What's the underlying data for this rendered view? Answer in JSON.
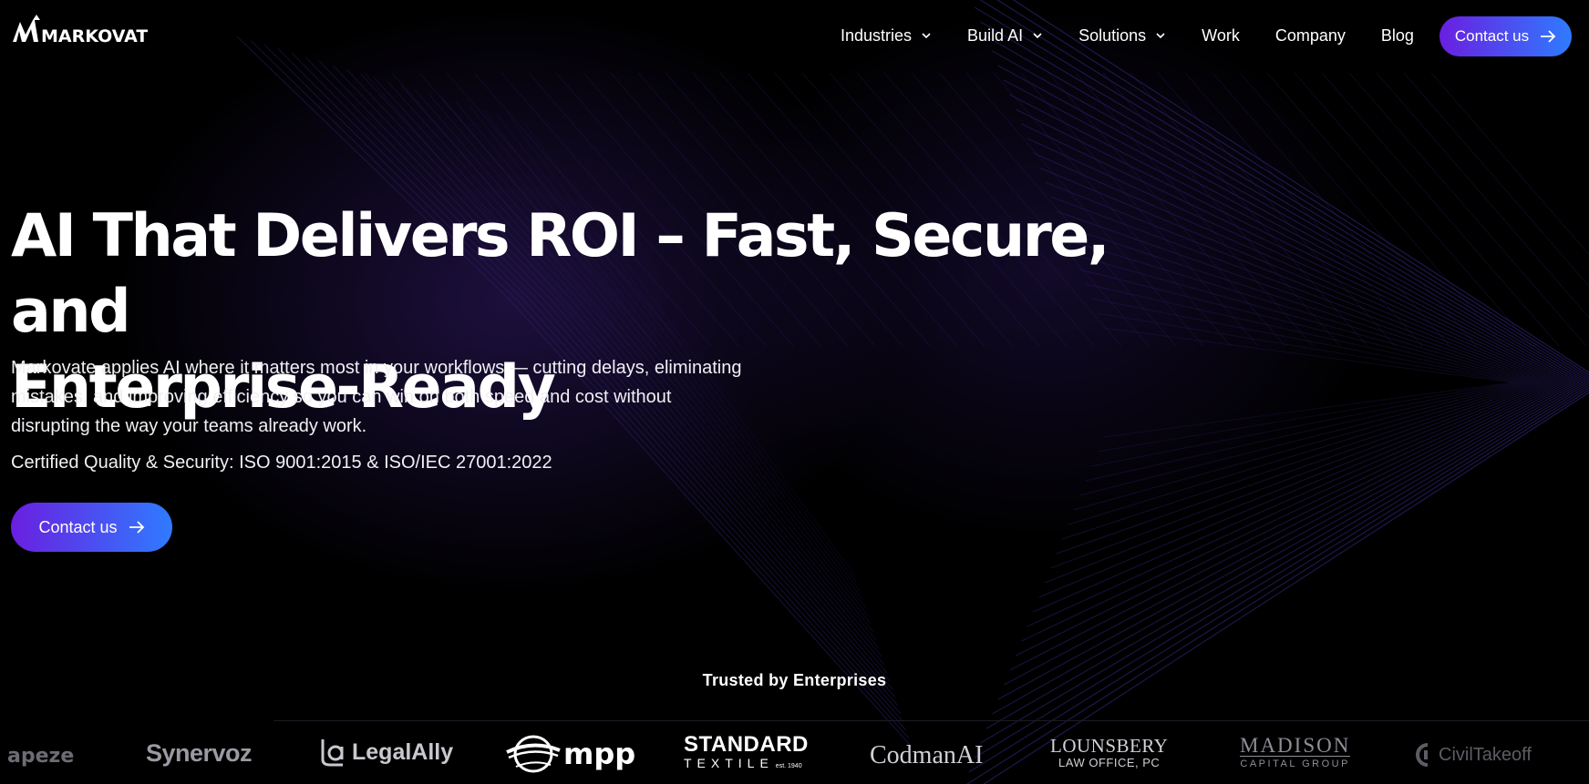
{
  "brand": {
    "name": "MARKOVATE"
  },
  "nav": {
    "items": [
      {
        "label": "Industries",
        "has_dropdown": true
      },
      {
        "label": "Build AI",
        "has_dropdown": true
      },
      {
        "label": "Solutions",
        "has_dropdown": true
      },
      {
        "label": "Work",
        "has_dropdown": false
      },
      {
        "label": "Company",
        "has_dropdown": false
      },
      {
        "label": "Blog",
        "has_dropdown": false
      }
    ],
    "cta_label": "Contact us"
  },
  "hero": {
    "headline_line1": "AI That Delivers ROI – Fast, Secure, and",
    "headline_line2": "Enterprise-Ready",
    "subtext_line1": "Markovate applies AI where it matters most in your workflows — cutting delays, eliminating",
    "subtext_line2": "mistakes, and improving efficiency so you can win on both speed and cost without",
    "subtext_line3": "disrupting the way your teams already work.",
    "certification": "Certified Quality & Security: ISO 9001:2015 & ISO/IEC 27001:2022",
    "cta_label": "Contact us"
  },
  "trusted": {
    "heading": "Trusted by Enterprises",
    "logos": [
      {
        "name": "apeze",
        "text": "apeze"
      },
      {
        "name": "synervoz",
        "text": "Synervoz"
      },
      {
        "name": "legalally",
        "text": "LegalAlly"
      },
      {
        "name": "mpp",
        "text": "mpp"
      },
      {
        "name": "standard-textile",
        "text": "STANDARD",
        "subtext": "TEXTILE",
        "small": "est. 1940"
      },
      {
        "name": "codmanai",
        "text": "CodmanAI"
      },
      {
        "name": "lounsbery",
        "text": "LOUNSBERY",
        "subtext": "LAW OFFICE, PC"
      },
      {
        "name": "madison",
        "text": "MADISON",
        "subtext": "CAPITAL GROUP"
      },
      {
        "name": "civiltakeoff",
        "text": "CivilTakeoff"
      }
    ]
  },
  "colors": {
    "accent_start": "#6a1fe0",
    "accent_end": "#2f7bff",
    "background": "#000000"
  }
}
